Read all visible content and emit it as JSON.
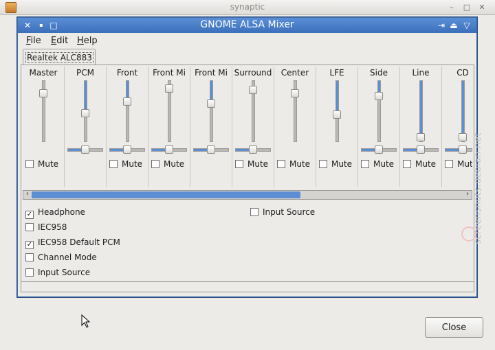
{
  "outer_window": {
    "title": "synaptic",
    "controls": {
      "minimize": "–",
      "maximize": "□",
      "close": "✕"
    },
    "close_button_label": "Close"
  },
  "mixer_window": {
    "title": "GNOME ALSA Mixer",
    "title_buttons": {
      "close": "✕",
      "minimize": "▪",
      "maximize": "□",
      "shade": "⇥",
      "raise": "⏏",
      "menu": "▽"
    },
    "menus": [
      {
        "label": "File"
      },
      {
        "label": "Edit"
      },
      {
        "label": "Help"
      }
    ],
    "tab": "Realtek ALC883",
    "mute_label": "Mute",
    "channels": [
      {
        "name": "Master",
        "volume": 0.85,
        "has_fill": false,
        "has_balance": false,
        "has_mute": true,
        "muted": false
      },
      {
        "name": "PCM",
        "volume": 0.5,
        "has_fill": true,
        "has_balance": true,
        "balance": 0.5,
        "has_mute": false
      },
      {
        "name": "Front",
        "volume": 0.7,
        "has_fill": true,
        "has_balance": true,
        "balance": 0.5,
        "has_mute": true,
        "muted": false
      },
      {
        "name": "Front Mi",
        "volume": 0.93,
        "has_fill": false,
        "has_balance": true,
        "balance": 0.5,
        "has_mute": true,
        "muted": false
      },
      {
        "name": "Front Mi",
        "volume": 0.67,
        "has_fill": true,
        "has_balance": true,
        "balance": 0.5,
        "has_mute": false
      },
      {
        "name": "Surround",
        "volume": 0.9,
        "has_fill": false,
        "has_balance": true,
        "balance": 0.5,
        "has_mute": true,
        "muted": false
      },
      {
        "name": "Center",
        "volume": 0.85,
        "has_fill": false,
        "has_balance": false,
        "has_mute": true,
        "muted": false
      },
      {
        "name": "LFE",
        "volume": 0.48,
        "has_fill": true,
        "has_balance": false,
        "has_mute": true,
        "muted": false
      },
      {
        "name": "Side",
        "volume": 0.8,
        "has_fill": true,
        "has_balance": true,
        "balance": 0.5,
        "has_mute": true,
        "muted": false
      },
      {
        "name": "Line",
        "volume": 0.08,
        "has_fill": true,
        "has_balance": true,
        "balance": 0.5,
        "has_mute": true,
        "muted": false
      },
      {
        "name": "CD",
        "volume": 0.08,
        "has_fill": true,
        "has_balance": true,
        "balance": 0.5,
        "has_mute": true,
        "muted": false
      }
    ],
    "scrollbar": {
      "position": 0.0,
      "visible_fraction": 0.62,
      "left_arrow": "‹",
      "right_arrow": "›"
    },
    "switches": [
      {
        "label": "Headphone",
        "checked": true
      },
      {
        "label": "IEC958",
        "checked": false
      },
      {
        "label": "IEC958 Default PCM",
        "checked": true
      },
      {
        "label": "Channel Mode",
        "checked": false
      },
      {
        "label": "Input Source",
        "checked": false
      },
      {
        "label": "Input Source",
        "checked": false
      }
    ]
  },
  "watermark": "screenshots.debian.net",
  "colors": {
    "accent": "#5b8ed3",
    "titlebar": "#3c6fba",
    "window_bg": "#ecebe8"
  }
}
